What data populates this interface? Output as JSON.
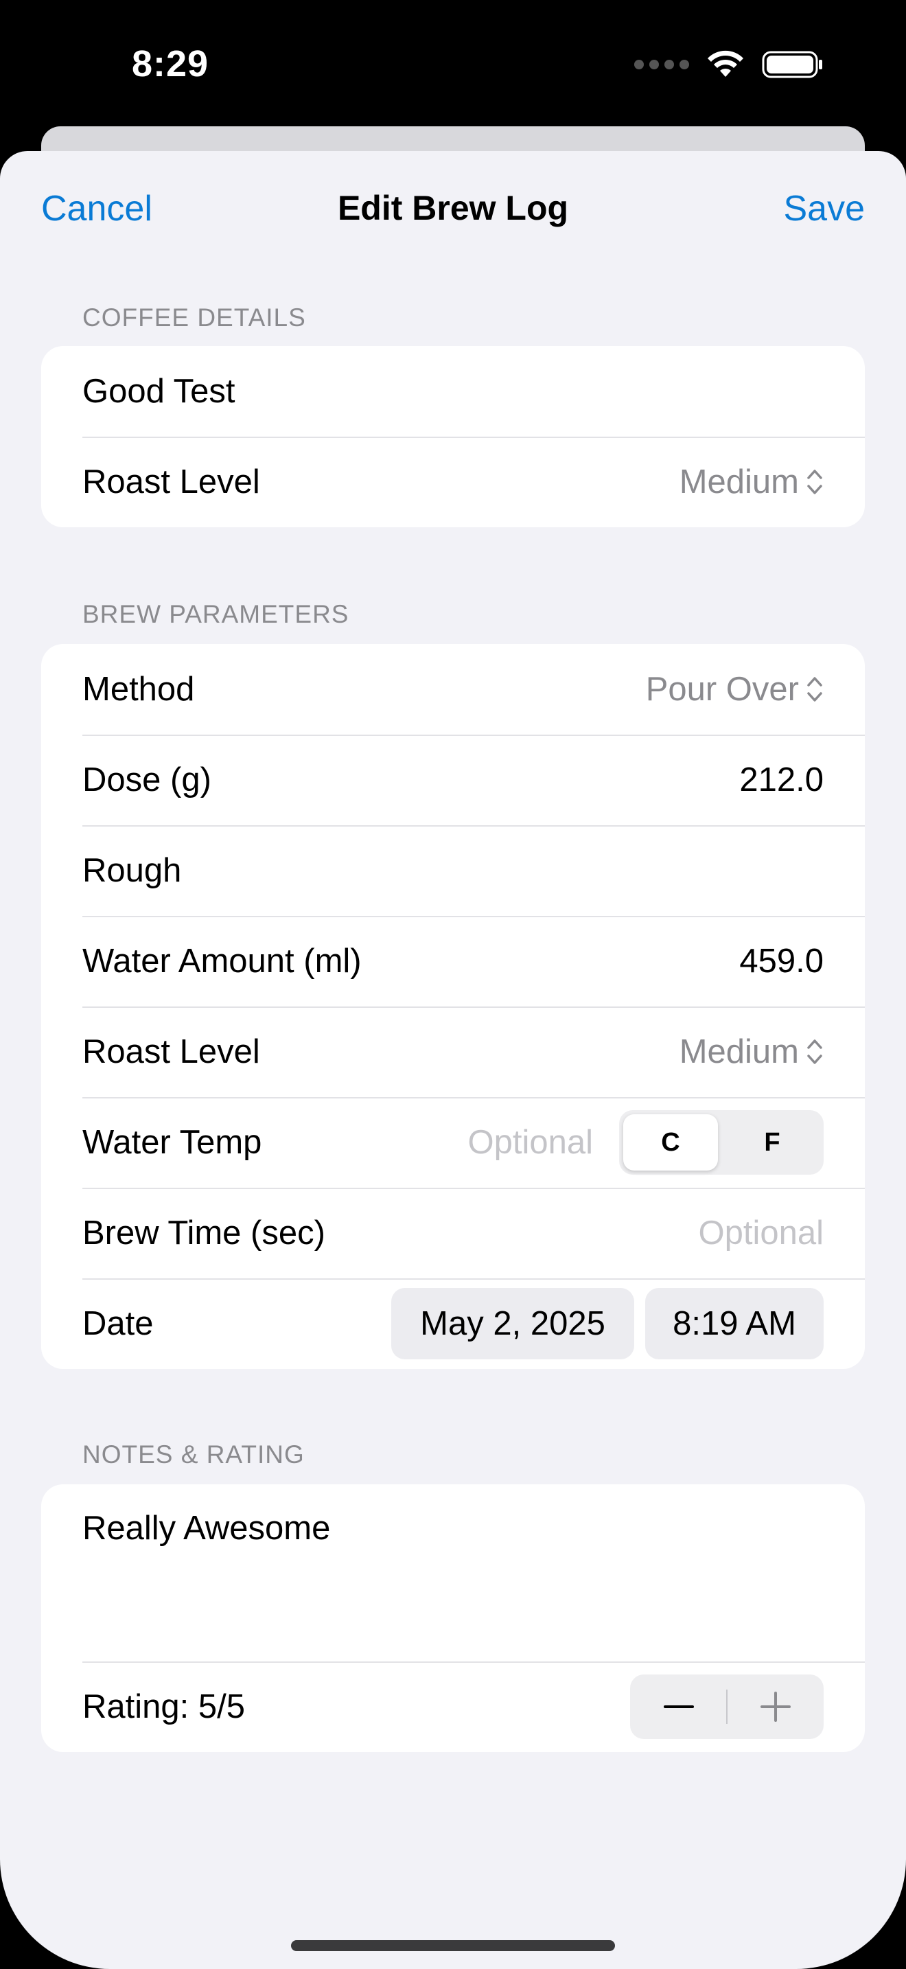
{
  "status_bar": {
    "time": "8:29"
  },
  "nav": {
    "cancel": "Cancel",
    "title": "Edit Brew Log",
    "save": "Save"
  },
  "coffee_details": {
    "header": "COFFEE DETAILS",
    "name": "Good Test",
    "roast_label": "Roast Level",
    "roast_value": "Medium"
  },
  "brew_parameters": {
    "header": "BREW PARAMETERS",
    "method_label": "Method",
    "method_value": "Pour Over",
    "dose_label": "Dose (g)",
    "dose_value": "212.0",
    "grind_value": "Rough",
    "water_amount_label": "Water Amount (ml)",
    "water_amount_value": "459.0",
    "roast_label": "Roast Level",
    "roast_value": "Medium",
    "water_temp_label": "Water Temp",
    "water_temp_placeholder": "Optional",
    "temp_unit_c": "C",
    "temp_unit_f": "F",
    "brew_time_label": "Brew Time (sec)",
    "brew_time_placeholder": "Optional",
    "date_label": "Date",
    "date_value": "May 2, 2025",
    "time_value": "8:19 AM"
  },
  "notes_rating": {
    "header": "NOTES & RATING",
    "notes": "Really Awesome",
    "rating_label": "Rating: 5/5",
    "rating": 5,
    "rating_max": 5
  },
  "colors": {
    "accent": "#0a7bd5",
    "background": "#f2f2f7",
    "card": "#ffffff",
    "secondary_text": "#8a8a8e",
    "placeholder": "#c4c4c8"
  }
}
